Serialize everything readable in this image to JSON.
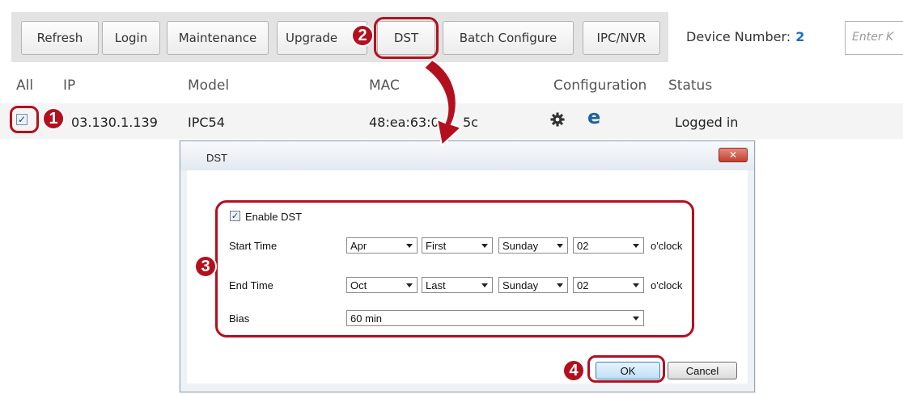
{
  "toolbar": {
    "buttons": [
      "Refresh",
      "Login",
      "Maintenance",
      "Upgrade",
      "DST",
      "Batch Configure",
      "IPC/NVR"
    ],
    "device_number_label": "Device Number:",
    "device_count": "2",
    "search_placeholder": "Enter K"
  },
  "table": {
    "headers": [
      "All",
      "IP",
      "Model",
      "MAC",
      "Configuration",
      "Status"
    ],
    "rows": [
      {
        "checked": true,
        "ip": "03.130.1.139",
        "model": "IPC54",
        "mac": "48:ea:63:0",
        "mac_tail": "5c",
        "status": "Logged in"
      }
    ]
  },
  "annotations": [
    "1",
    "2",
    "3",
    "4"
  ],
  "dialog": {
    "title": "DST",
    "close_label": "✕",
    "enable_label": "Enable DST",
    "enable_checked": true,
    "start_label": "Start Time",
    "end_label": "End Time",
    "bias_label": "Bias",
    "oclock": "o'clock",
    "start": {
      "month": "Apr",
      "week": "First",
      "day": "Sunday",
      "hour": "02"
    },
    "end": {
      "month": "Oct",
      "week": "Last",
      "day": "Sunday",
      "hour": "02"
    },
    "bias": "60 min",
    "ok_label": "OK",
    "cancel_label": "Cancel"
  },
  "colors": {
    "annotation_red": "#b3101f",
    "device_count_blue": "#1a6fbf"
  },
  "icons": {
    "config_gear": "gear-icon",
    "config_browser": "browser-icon"
  }
}
